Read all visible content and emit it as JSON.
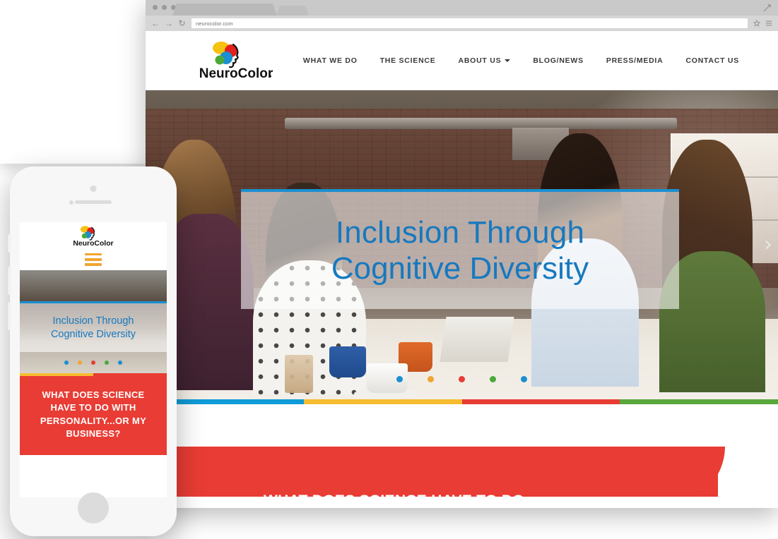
{
  "browser": {
    "url": "neurocolor.com",
    "back_icon": "back-arrow-icon",
    "forward_icon": "forward-arrow-icon",
    "reload_icon": "reload-icon",
    "bookmark_icon": "star-icon",
    "menu_icon": "hamburger-menu-icon",
    "maximize_icon": "maximize-icon"
  },
  "site": {
    "logo_text": "NeuroColor",
    "nav": [
      {
        "label": "WHAT WE DO",
        "has_caret": false
      },
      {
        "label": "THE SCIENCE",
        "has_caret": false
      },
      {
        "label": "ABOUT US",
        "has_caret": true
      },
      {
        "label": "BLOG/NEWS",
        "has_caret": false
      },
      {
        "label": "PRESS/MEDIA",
        "has_caret": false
      },
      {
        "label": "CONTACT US",
        "has_caret": false
      }
    ],
    "hero": {
      "line1": "Inclusion Through",
      "line2": "Cognitive Diversity",
      "title_color": "#1779bf",
      "accent_top_color": "#1a8fd1",
      "next_arrow": "›",
      "dots": [
        {
          "color": "#1a8fd1",
          "active": true
        },
        {
          "color": "#f0a531",
          "active": false
        },
        {
          "color": "#e83c34",
          "active": false
        },
        {
          "color": "#4aa93a",
          "active": false
        },
        {
          "color": "#1a8fd1",
          "active": false
        }
      ]
    },
    "colorbar": [
      "#0f9bd7",
      "#f6bc2f",
      "#e83c34",
      "#5aa83c"
    ],
    "red_section": {
      "headline": "WHAT DOES SCIENCE HAVE TO DO",
      "background": "#e83c34"
    }
  },
  "phone": {
    "logo_text": "NeuroColor",
    "menu_icon": "hamburger-menu-icon",
    "menu_color": "#f0a531",
    "hero": {
      "line1": "Inclusion Through",
      "line2": "Cognitive Diversity",
      "dots": [
        {
          "color": "#1a8fd1"
        },
        {
          "color": "#f0a531"
        },
        {
          "color": "#e83c34"
        },
        {
          "color": "#4aa93a"
        },
        {
          "color": "#1a8fd1"
        }
      ]
    },
    "colorbar": [
      "#f6bc2f",
      "#e83c34"
    ],
    "red_section": {
      "line1": "WHAT DOES SCIENCE",
      "line2": "HAVE TO DO WITH",
      "line3": "PERSONALITY...OR MY",
      "line4": "BUSINESS?"
    }
  }
}
